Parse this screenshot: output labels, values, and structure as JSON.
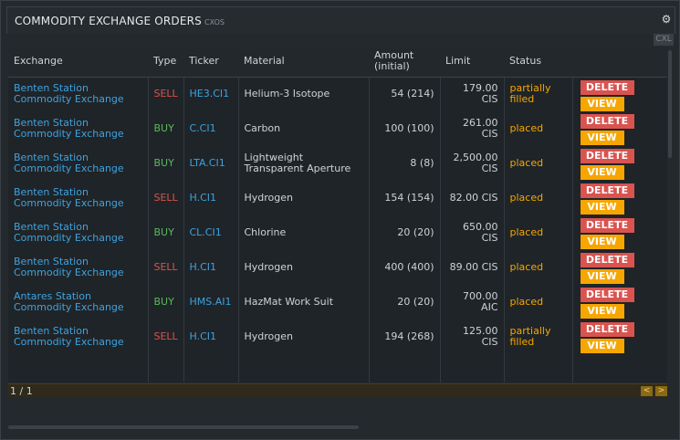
{
  "window": {
    "title": "COMMODITY EXCHANGE ORDERS",
    "code": "CXOS",
    "cxl_label": "CXL"
  },
  "columns": {
    "exchange": "Exchange",
    "type": "Type",
    "ticker": "Ticker",
    "material": "Material",
    "amount": "Amount",
    "amount_sub": "(initial)",
    "limit": "Limit",
    "status": "Status"
  },
  "buttons": {
    "delete": "DELETE",
    "view": "VIEW"
  },
  "orders": [
    {
      "exchange": "Benten Station Commodity Exchange",
      "type": "SELL",
      "ticker": "HE3.CI1",
      "material": "Helium-3 Isotope",
      "amount": "54 (214)",
      "limit": "179.00 CIS",
      "status": "partially filled"
    },
    {
      "exchange": "Benten Station Commodity Exchange",
      "type": "BUY",
      "ticker": "C.CI1",
      "material": "Carbon",
      "amount": "100 (100)",
      "limit": "261.00 CIS",
      "status": "placed"
    },
    {
      "exchange": "Benten Station Commodity Exchange",
      "type": "BUY",
      "ticker": "LTA.CI1",
      "material": "Lightweight Transparent Aperture",
      "amount": "8 (8)",
      "limit": "2,500.00 CIS",
      "status": "placed"
    },
    {
      "exchange": "Benten Station Commodity Exchange",
      "type": "SELL",
      "ticker": "H.CI1",
      "material": "Hydrogen",
      "amount": "154 (154)",
      "limit": "82.00 CIS",
      "status": "placed"
    },
    {
      "exchange": "Benten Station Commodity Exchange",
      "type": "BUY",
      "ticker": "CL.CI1",
      "material": "Chlorine",
      "amount": "20 (20)",
      "limit": "650.00 CIS",
      "status": "placed"
    },
    {
      "exchange": "Benten Station Commodity Exchange",
      "type": "SELL",
      "ticker": "H.CI1",
      "material": "Hydrogen",
      "amount": "400 (400)",
      "limit": "89.00 CIS",
      "status": "placed"
    },
    {
      "exchange": "Antares Station Commodity Exchange",
      "type": "BUY",
      "ticker": "HMS.AI1",
      "material": "HazMat Work Suit",
      "amount": "20 (20)",
      "limit": "700.00 AIC",
      "status": "placed"
    },
    {
      "exchange": "Benten Station Commodity Exchange",
      "type": "SELL",
      "ticker": "H.CI1",
      "material": "Hydrogen",
      "amount": "194 (268)",
      "limit": "125.00 CIS",
      "status": "partially filled"
    }
  ],
  "pager": {
    "text": "1 / 1",
    "prev": "<",
    "next": ">"
  },
  "icons": {
    "settings": "gear-icon"
  },
  "colors": {
    "exchange_link": "#3fa2de",
    "sell": "#d9534f",
    "buy": "#5cb85c",
    "status": "#f7a600",
    "delete_button": "#d9534f",
    "view_button": "#f7a600"
  }
}
